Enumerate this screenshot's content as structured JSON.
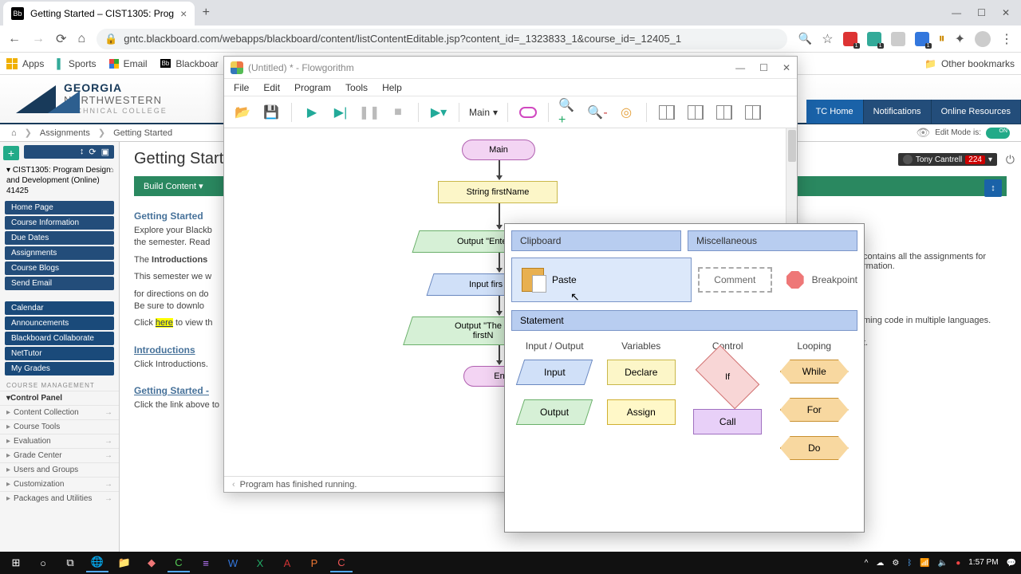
{
  "browser": {
    "tab_title": "Getting Started – CIST1305: Prog",
    "tab_favicon": "Bb",
    "url": "gntc.blackboard.com/webapps/blackboard/content/listContentEditable.jsp?content_id=_1323833_1&course_id=_12405_1",
    "bookmarks": {
      "apps": "Apps",
      "sports": "Sports",
      "email": "Email",
      "blackboard": "Blackboar",
      "other": "Other bookmarks"
    }
  },
  "blackboard": {
    "logo": {
      "l1": "GEORGIA",
      "l2": "NORTHWESTERN",
      "l3": "TECHNICAL COLLEGE"
    },
    "user": {
      "name": "Tony Cantrell",
      "badge": "224"
    },
    "tabs": {
      "home": "TC Home",
      "notifications": "Notifications",
      "resources": "Online Resources"
    },
    "breadcrumb": {
      "assignments": "Assignments",
      "current": "Getting Started"
    },
    "edit_mode_label": "Edit Mode is:",
    "side": {
      "course": "CIST1305: Program Design and Development (Online) 41425",
      "links": [
        "Home Page",
        "Course Information",
        "Due Dates",
        "Assignments",
        "Course Blogs",
        "Send Email"
      ],
      "links2": [
        "Calendar",
        "Announcements",
        "Blackboard Collaborate",
        "NetTutor",
        "My Grades"
      ],
      "mgmt_hdr": "COURSE MANAGEMENT",
      "cp": "Control Panel",
      "cp_items": [
        "Content Collection",
        "Course Tools",
        "Evaluation",
        "Grade Center",
        "Users and Groups",
        "Customization",
        "Packages and Utilities"
      ]
    },
    "main": {
      "title": "Getting Start",
      "build": "Build Content",
      "item1_h": "Getting Started",
      "item1_p1a": "Explore your Blackb",
      "item1_p1b": "the semester. Read",
      "item1_p2a": "The ",
      "item1_p2b": "Introductions",
      "item1_p3": "This semester we w",
      "item1_p4a": "for directions on do",
      "item1_p4b": "Be sure to downlo",
      "item1_p5a": "Click ",
      "item1_p5b": "here",
      "item1_p5c": " to view th",
      "item1_r1": " contains all the assignments for",
      "item1_r1b": "rmation.",
      "item1_r2": "ming code in multiple languages.",
      "item1_r3": "t.",
      "item2_h": "Introductions",
      "item2_p": "Click Introductions.",
      "item3_h": "Getting Started -",
      "item3_p": "Click the link above to"
    }
  },
  "flowgorithm": {
    "title": "(Untitled) * - Flowgorithm",
    "menu": [
      "File",
      "Edit",
      "Program",
      "Tools",
      "Help"
    ],
    "main_select": "Main",
    "nodes": {
      "main": "Main",
      "declare": "String firstName",
      "out1": "Output \"Enter",
      "in1": "Input firs",
      "out2": "Output \"The fir\nfirstN",
      "end": "En"
    },
    "status": "Program has finished running."
  },
  "palette": {
    "clipboard": "Clipboard",
    "misc": "Miscellaneous",
    "paste": "Paste",
    "comment": "Comment",
    "breakpoint": "Breakpoint",
    "statement": "Statement",
    "cats": [
      "Input / Output",
      "Variables",
      "Control",
      "Looping"
    ],
    "shapes": {
      "input": "Input",
      "output": "Output",
      "declare": "Declare",
      "assign": "Assign",
      "if": "If",
      "call": "Call",
      "while": "While",
      "for": "For",
      "do": "Do"
    }
  },
  "taskbar": {
    "time": "1:57 PM"
  }
}
